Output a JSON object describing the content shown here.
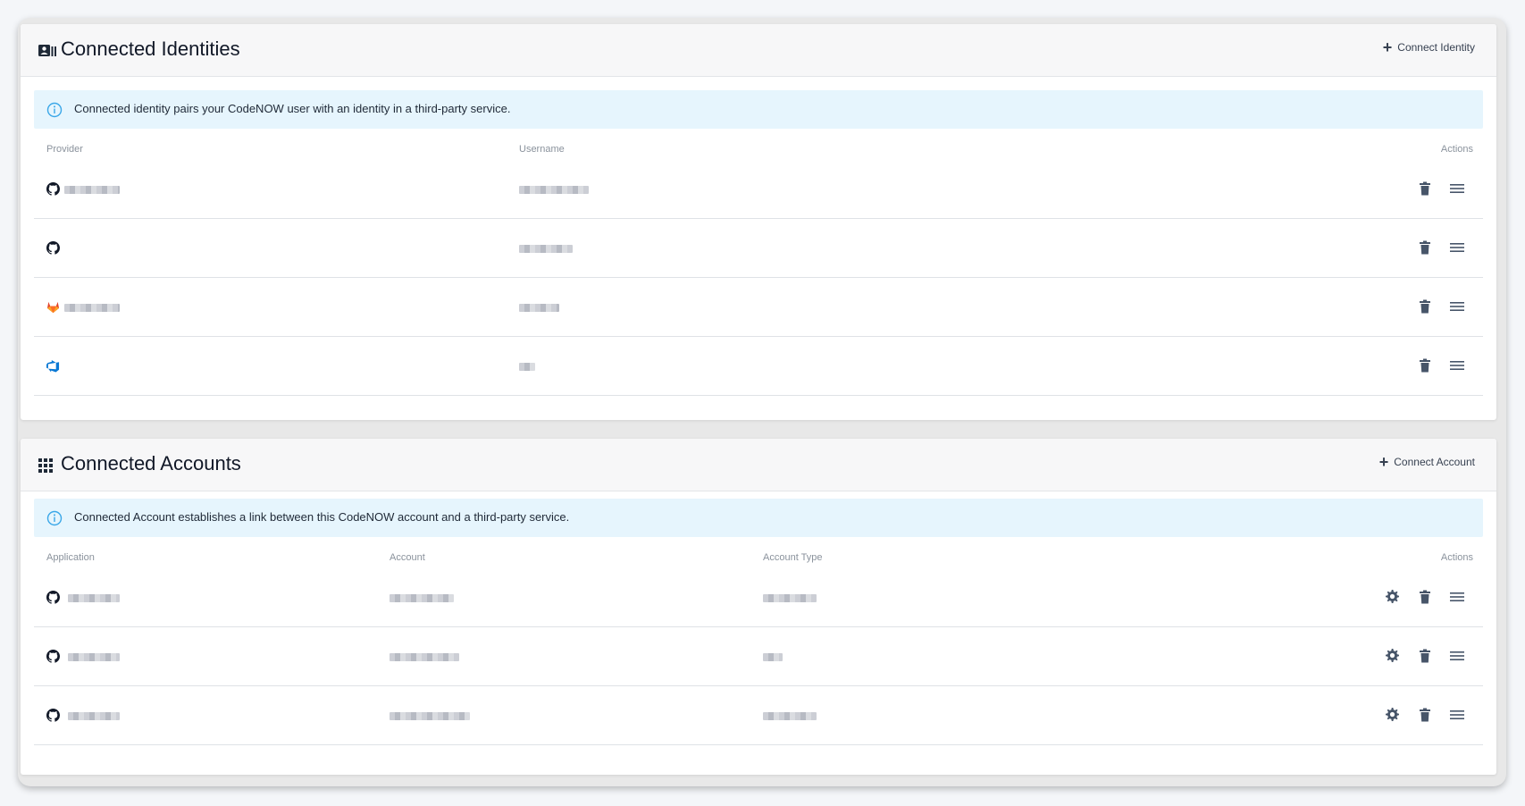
{
  "identities": {
    "title": "Connected Identities",
    "header_icon": "id-card-icon",
    "connect_label": "Connect Identity",
    "info": "Connected identity pairs your CodeNOW user with an identity in a third-party service.",
    "columns": {
      "provider": "Provider",
      "username": "Username",
      "actions": "Actions"
    },
    "rows": [
      {
        "provider_icon": "github-icon"
      },
      {
        "provider_icon": "github-icon"
      },
      {
        "provider_icon": "gitlab-icon"
      },
      {
        "provider_icon": "azure-devops-icon"
      }
    ]
  },
  "accounts": {
    "title": "Connected Accounts",
    "header_icon": "apps-grid-icon",
    "connect_label": "Connect Account",
    "info": "Connected Account establishes a link between this CodeNOW account and a third-party service.",
    "columns": {
      "application": "Application",
      "account": "Account",
      "account_type": "Account Type",
      "actions": "Actions"
    },
    "rows": [
      {
        "app_icon": "github-icon"
      },
      {
        "app_icon": "github-icon"
      },
      {
        "app_icon": "github-icon"
      }
    ]
  },
  "colors": {
    "info_bg": "#e6f5fd",
    "info_icon": "#3aa7e8",
    "gitlab": "#e2432a",
    "azure": "#0a78d4",
    "icon_dark": "#475569"
  }
}
